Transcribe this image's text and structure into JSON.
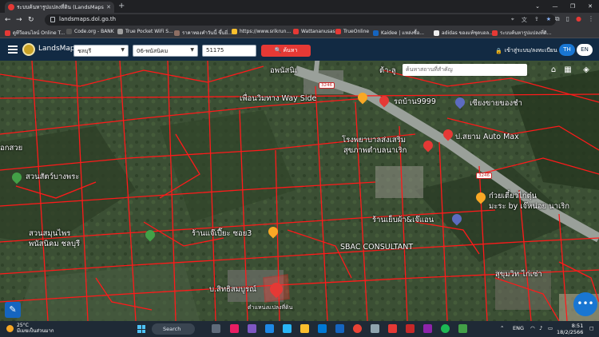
{
  "browser": {
    "tab_title": "ระบบค้นหารูปแปลงที่ดิน (LandsMaps",
    "new_tab": "+",
    "url": "landsmaps.dol.go.th",
    "window_controls": [
      "⌄",
      "—",
      "❐",
      "✕"
    ]
  },
  "bookmarks": [
    {
      "label": "ดูทีวีออนไลน์ Online T...",
      "color": "#e53935"
    },
    {
      "label": "Code.org - BANK",
      "color": "#555"
    },
    {
      "label": "True Pocket WiFi S...",
      "color": "#9e9e9e"
    },
    {
      "label": "ราคาทองคำวันนี้ ขึ้นยี่...",
      "color": "#8d6e63"
    },
    {
      "label": "https://www.srikrun...",
      "color": "#fbc02d"
    },
    {
      "label": "Wattananusas",
      "color": "#e53935"
    },
    {
      "label": "TrueOnline",
      "color": "#e53935"
    },
    {
      "label": "Kaidee | แหล่งซื้อ...",
      "color": "#1565c0"
    },
    {
      "label": "adidas ของแท้ชุดบอล...",
      "color": "#fff"
    },
    {
      "label": "ระบบค้นหารูปแปลงที่ดิ...",
      "color": "#e53935"
    }
  ],
  "app": {
    "brand": "LandsMaps",
    "province": "ชลบุรี",
    "district": "06-พนัสนิคม",
    "parcel_number": "51175",
    "search_label": "ค้นหา",
    "login_label": "เข้าสู่ระบบ/ลงทะเบียน",
    "lang_th": "TH",
    "lang_en": "EN",
    "place_search_placeholder": "ค้นหาสถานที่สำคัญ"
  },
  "map_labels": {
    "l1": "อพนัสนิเ",
    "l2": "ต้า-ลู",
    "l3": "เพื่อนวิมทาง Way Side",
    "l4": "รถบ้าน9999",
    "l5": "เซียงขายของชำ",
    "l6": "ป.สยาม Auto Max",
    "l7": "โรงพยาบาลส่งเสริม",
    "l8": "สุขภาพตำบลนาเริก",
    "l9": "อกสวย",
    "l10": "สวนสัตว์บางพระ",
    "l11": "ก๋วยเตี๋ยวไก่ตุ๋น",
    "l12": "มะระ by เจ๊หน่อย นาเริก",
    "l13": "ร้านเย็บผ้า&เจ๊แอน",
    "l14": "สวนสมุนไพร",
    "l15": "พนัสนิคม ชลบุรี",
    "l16": "ร้านแจ๊เปี๊ยะ ซอย3",
    "l17": "SBAC CONSULTANT",
    "l18": "บ.สิทธิสมบูรณ์",
    "l19": "ตำแหน่งแปลงที่ดิน",
    "l20": "สุขุมวิท ไก่เซ่า",
    "road1": "3246",
    "road2": "3246"
  },
  "taskbar": {
    "temp": "25°C",
    "weather": "มีเมฆเป็นส่วนมาก",
    "search": "Search",
    "lang": "ENG",
    "time": "8:51",
    "date": "18/2/2566"
  },
  "colors": {
    "topbar": "#122a43",
    "accent_red": "#e53935",
    "lang_active": "#1976d2"
  }
}
